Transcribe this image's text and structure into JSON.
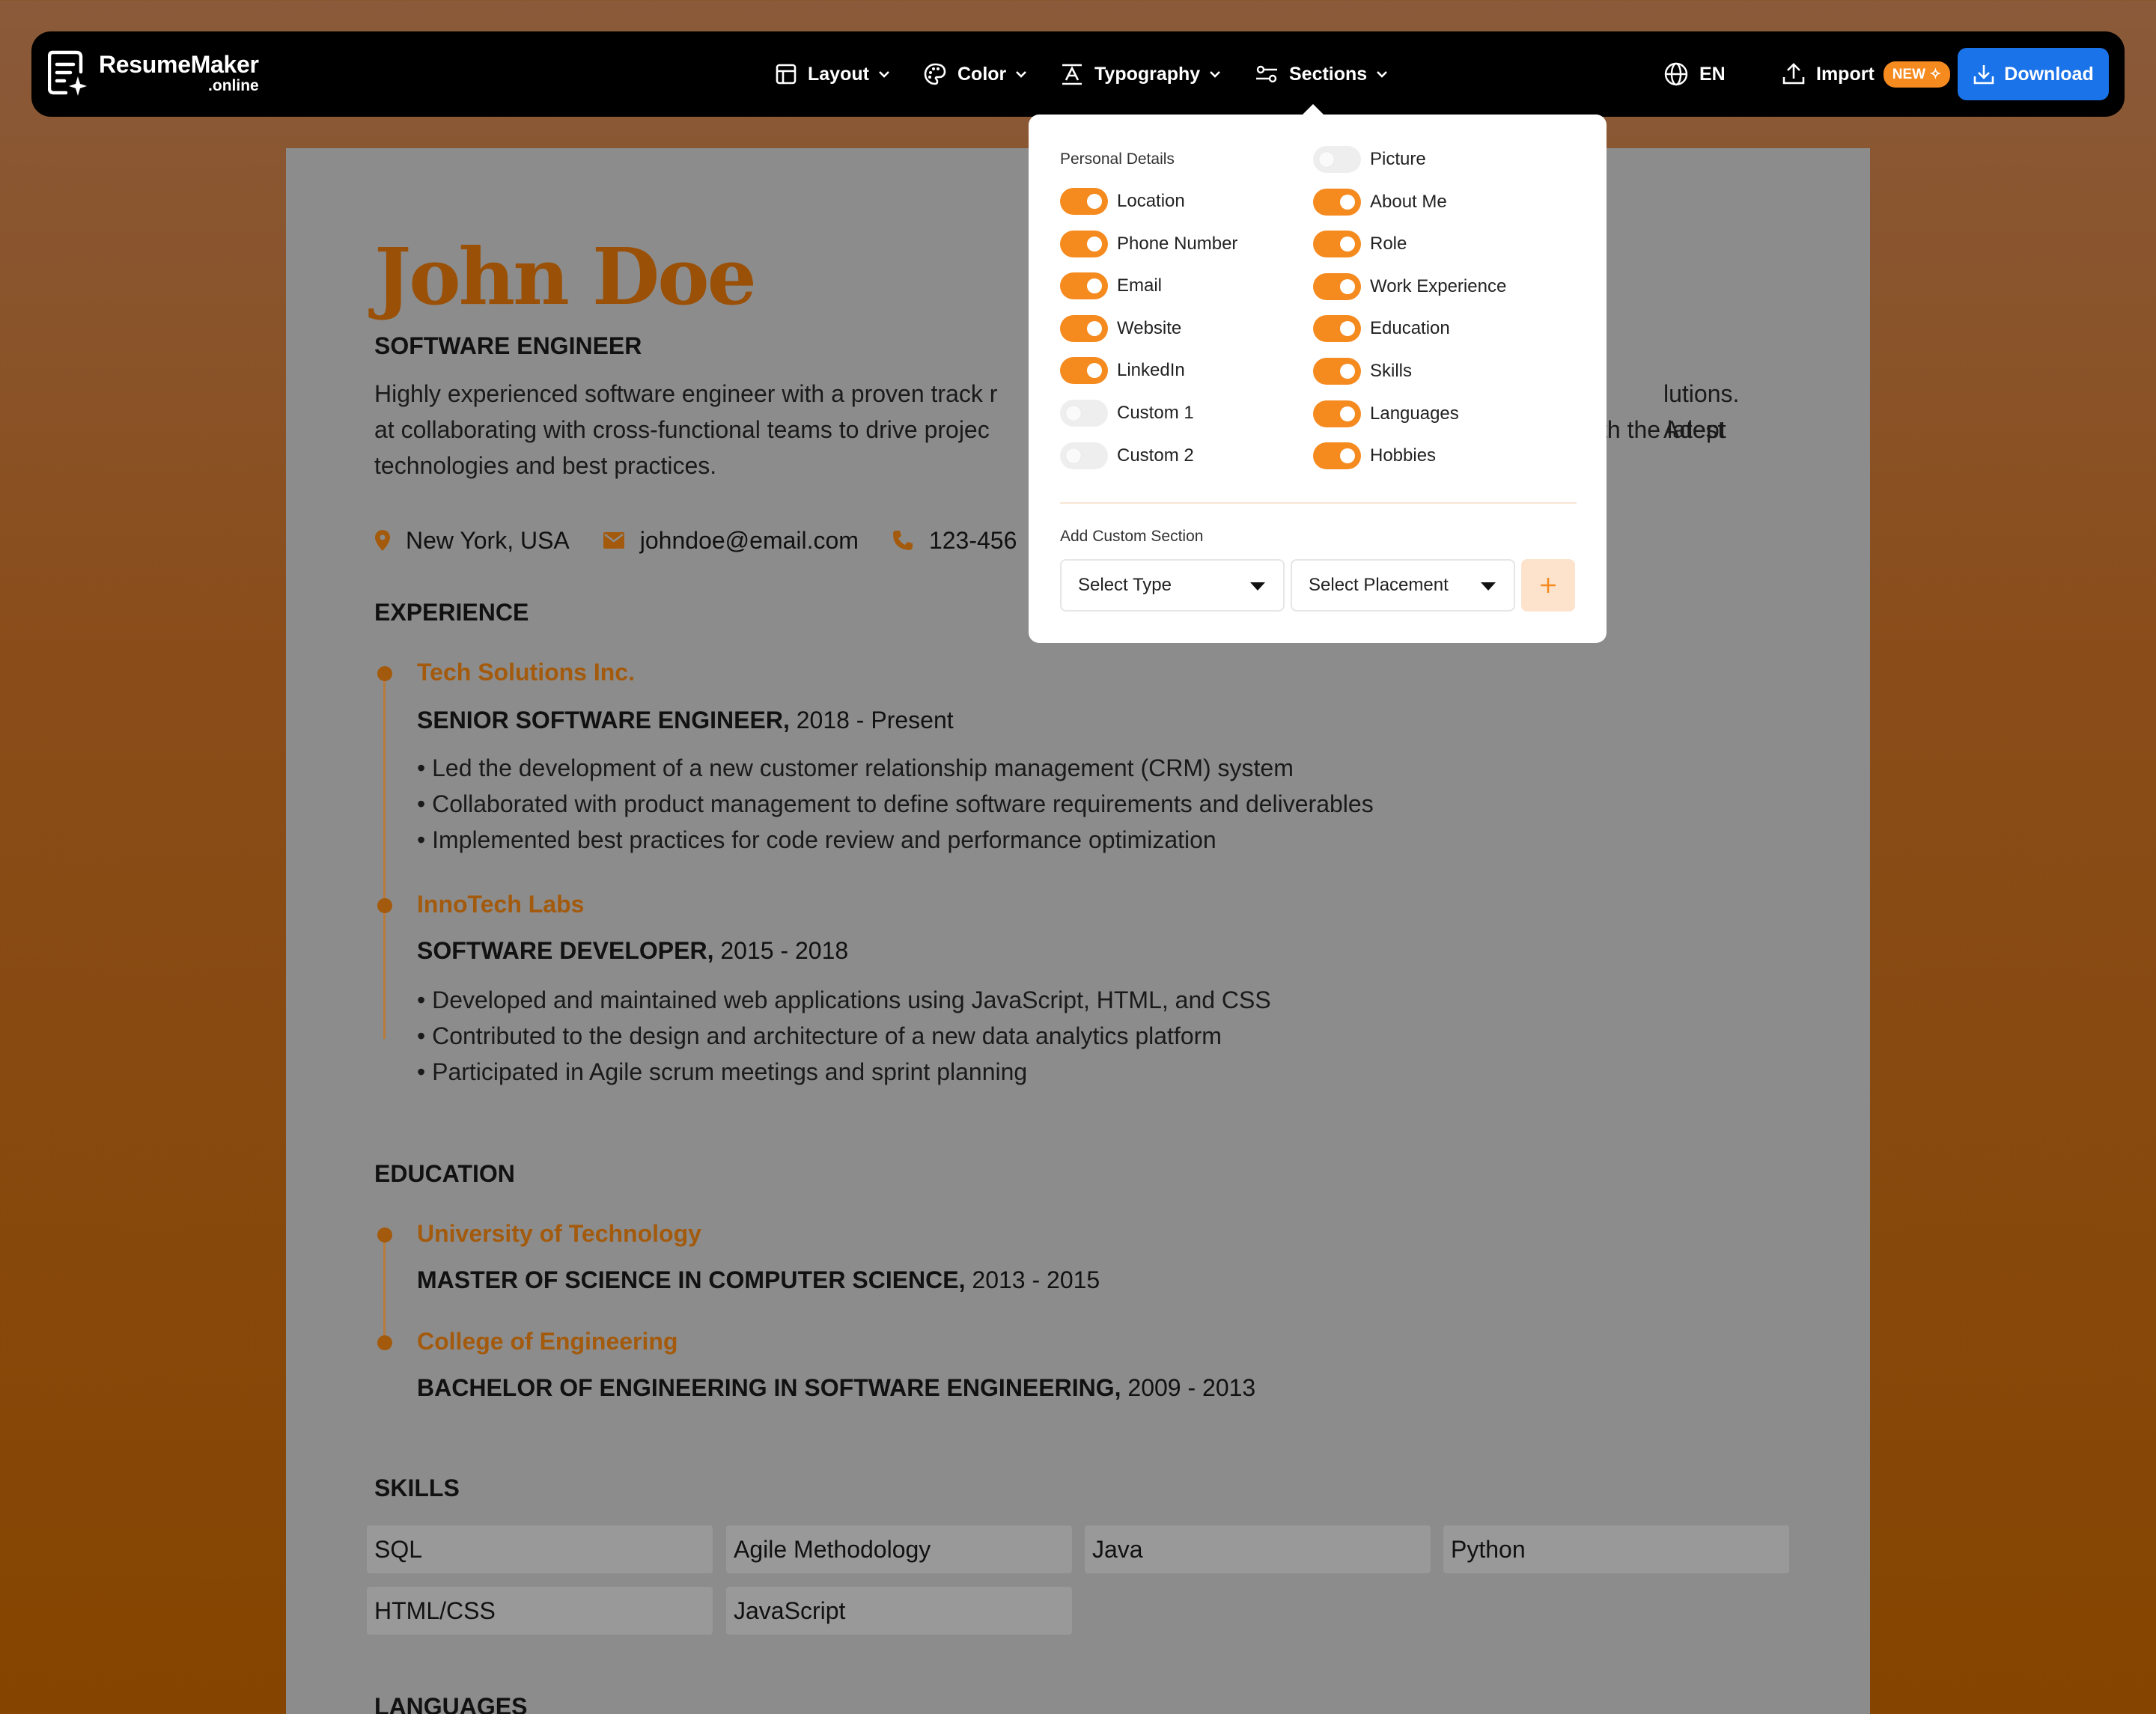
{
  "navbar": {
    "logo_main": "ResumeMaker",
    "logo_sub": ".online",
    "menus": [
      "Layout",
      "Color",
      "Typography",
      "Sections"
    ],
    "language": "EN",
    "import_label": "Import",
    "new_badge": "NEW ✧",
    "download_label": "Download"
  },
  "resume": {
    "name": "John Doe",
    "role": "SOFTWARE ENGINEER",
    "summary_visible": [
      "Highly experienced software engineer with a proven track r",
      "lutions. Adept",
      "at collaborating with cross-functional teams to drive projec",
      "th the latest",
      "technologies and best practices."
    ],
    "contact": {
      "location": "New York, USA",
      "email": "johndoe@email.com",
      "phone": "123-456"
    },
    "experience_title": "EXPERIENCE",
    "experience": [
      {
        "org": "Tech Solutions Inc.",
        "position": "SENIOR SOFTWARE ENGINEER,",
        "dates": "2018 - Present",
        "bullets": [
          "• Led the development of a new customer relationship management (CRM) system",
          "• Collaborated with product management to define software requirements and deliverables",
          "• Implemented best practices for code review and performance optimization"
        ]
      },
      {
        "org": "InnoTech Labs",
        "position": "SOFTWARE DEVELOPER,",
        "dates": "2015 - 2018",
        "bullets": [
          "• Developed and maintained web applications using JavaScript, HTML, and CSS",
          "• Contributed to the design and architecture of a new data analytics platform",
          "• Participated in Agile scrum meetings and sprint planning"
        ]
      }
    ],
    "education_title": "EDUCATION",
    "education": [
      {
        "org": "University of Technology",
        "degree": "MASTER OF SCIENCE IN COMPUTER SCIENCE,",
        "dates": "2013 - 2015"
      },
      {
        "org": "College of Engineering",
        "degree": "BACHELOR OF ENGINEERING IN SOFTWARE ENGINEERING,",
        "dates": "2009 - 2013"
      }
    ],
    "skills_title": "SKILLS",
    "skills": [
      "SQL",
      "Agile Methodology",
      "Java",
      "Python",
      "HTML/CSS",
      "JavaScript"
    ],
    "languages_title": "LANGUAGES"
  },
  "sections_dropdown": {
    "personal_details_label": "Personal Details",
    "left_toggles": [
      {
        "label": "Location",
        "on": true
      },
      {
        "label": "Phone Number",
        "on": true
      },
      {
        "label": "Email",
        "on": true
      },
      {
        "label": "Website",
        "on": true
      },
      {
        "label": "LinkedIn",
        "on": true
      },
      {
        "label": "Custom 1",
        "on": false
      },
      {
        "label": "Custom 2",
        "on": false
      }
    ],
    "right_toggles": [
      {
        "label": "Picture",
        "on": false
      },
      {
        "label": "About Me",
        "on": true
      },
      {
        "label": "Role",
        "on": true
      },
      {
        "label": "Work Experience",
        "on": true
      },
      {
        "label": "Education",
        "on": true
      },
      {
        "label": "Skills",
        "on": true
      },
      {
        "label": "Languages",
        "on": true
      },
      {
        "label": "Hobbies",
        "on": true
      }
    ],
    "add_custom_label": "Add Custom Section",
    "select_type": "Select Type",
    "select_placement": "Select Placement"
  },
  "colors": {
    "accent": "#f58a1f",
    "name_color": "#9a5006",
    "download_blue": "#1a73e8"
  }
}
